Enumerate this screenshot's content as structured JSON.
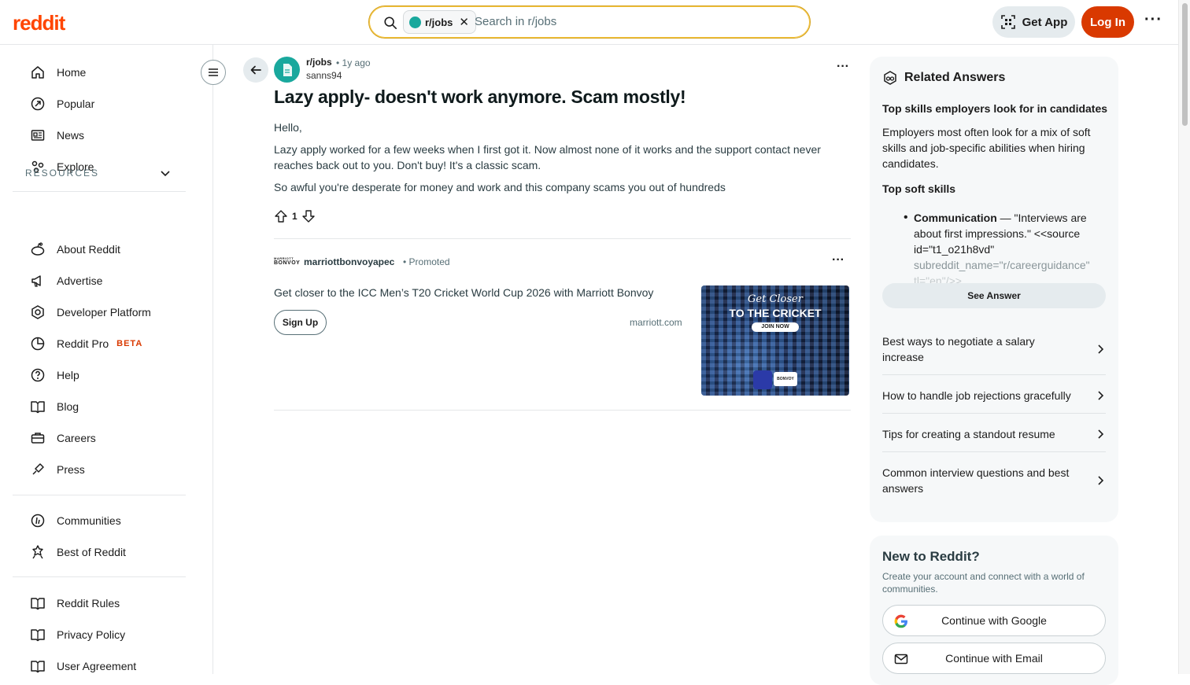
{
  "header": {
    "logo": "reddit",
    "search_chip": "r/jobs",
    "search_placeholder": "Search in r/jobs",
    "get_app": "Get App",
    "login": "Log In"
  },
  "sidebar": {
    "main": [
      {
        "label": "Home",
        "icon": "home-icon"
      },
      {
        "label": "Popular",
        "icon": "popular-icon"
      },
      {
        "label": "News",
        "icon": "news-icon"
      },
      {
        "label": "Explore",
        "icon": "explore-icon"
      }
    ],
    "resources_header": "RESOURCES",
    "resources": [
      {
        "label": "About Reddit",
        "icon": "reddit-alien-icon"
      },
      {
        "label": "Advertise",
        "icon": "megaphone-icon"
      },
      {
        "label": "Developer Platform",
        "icon": "developer-icon"
      },
      {
        "label": "Reddit Pro",
        "icon": "pro-chart-icon",
        "badge": "BETA"
      },
      {
        "label": "Help",
        "icon": "help-icon"
      },
      {
        "label": "Blog",
        "icon": "book-icon"
      },
      {
        "label": "Careers",
        "icon": "briefcase-icon"
      },
      {
        "label": "Press",
        "icon": "press-icon"
      }
    ],
    "community": [
      {
        "label": "Communities",
        "icon": "communities-icon"
      },
      {
        "label": "Best of Reddit",
        "icon": "best-of-icon"
      }
    ],
    "legal": [
      {
        "label": "Reddit Rules",
        "icon": "rules-book-icon"
      },
      {
        "label": "Privacy Policy",
        "icon": "privacy-book-icon"
      },
      {
        "label": "User Agreement",
        "icon": "agreement-book-icon"
      }
    ]
  },
  "post": {
    "subreddit": "r/jobs",
    "time": "• 1y ago",
    "author": "sanns94",
    "title": "Lazy apply- doesn't work anymore. Scam mostly!",
    "paragraphs": [
      "Hello,",
      "Lazy apply worked for a few weeks when I first got it. Now almost none of it works and the support contact never reaches back out to you. Don't buy! It's a classic scam.",
      "So awful you're desperate for money and work and this company scams you out of hundreds"
    ],
    "score": "1"
  },
  "ad": {
    "logo_top": "MARRIOTT",
    "logo_bottom": "BONVOY",
    "advertiser": "marriottbonvoyapec",
    "promoted": "Promoted",
    "headline": "Get closer to the ICC Men’s T20 Cricket World Cup 2026 with Marriott Bonvoy",
    "cta": "Sign Up",
    "domain": "marriott.com",
    "image_line1": "Get Closer",
    "image_line2": "TO THE CRICKET",
    "image_button": "JOIN NOW",
    "image_badge": "BONVOY"
  },
  "related": {
    "heading": "Related Answers",
    "question": "Top skills employers look for in candidates",
    "answer": "Employers most often look for a mix of soft skills and job-specific abilities when hiring candidates.",
    "subheading": "Top soft skills",
    "bullet_bold": "Communication",
    "bullet_text": " — \"Interviews are about first impressions.\" <<source id=\"t1_o21h8vd\"",
    "bullet_fade": "subreddit_name=\"",
    "bullet_link": "r/careerguidance",
    "bullet_fade_end": "\"",
    "bullet_faded_line": "tl=\"en\"/>>",
    "see_answer": "See Answer",
    "items": [
      "Best ways to negotiate a salary increase",
      "How to handle job rejections gracefully",
      "Tips for creating a standout resume",
      "Common interview questions and best answers"
    ]
  },
  "signup": {
    "title": "New to Reddit?",
    "subtitle": "Create your account and connect with a world of communities.",
    "google": "Continue with Google",
    "email": "Continue with Email"
  }
}
